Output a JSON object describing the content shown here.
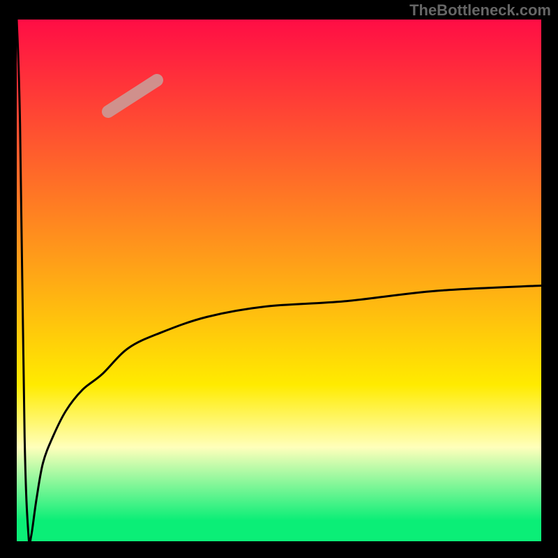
{
  "watermark": "TheBottleneck.com",
  "colors": {
    "top": "#FF0D45",
    "mid1": "#FF9A1A",
    "mid2": "#FFEB00",
    "pale": "#FFFFBB",
    "bottom": "#0BEE77",
    "border": "#000000",
    "curve": "#000000",
    "highlight": "#CC9A96"
  },
  "chart_data": {
    "type": "line",
    "title": "",
    "xlabel": "",
    "ylabel": "",
    "ylim": [
      0,
      100
    ],
    "xlim": [
      0,
      800
    ],
    "x": [
      0,
      5,
      12,
      18,
      22,
      30,
      40,
      55,
      75,
      100,
      130,
      170,
      220,
      290,
      380,
      500,
      640,
      800
    ],
    "y": [
      0,
      20,
      80,
      99,
      99,
      92,
      85,
      80,
      75,
      71,
      68,
      63,
      60,
      57,
      55,
      54,
      52,
      51
    ],
    "gradient_stops": [
      {
        "offset": 0.0,
        "color": "#FF0D45"
      },
      {
        "offset": 0.45,
        "color": "#FF9A1A"
      },
      {
        "offset": 0.7,
        "color": "#FFEB00"
      },
      {
        "offset": 0.82,
        "color": "#FFFFBB"
      },
      {
        "offset": 0.96,
        "color": "#0BEE77"
      },
      {
        "offset": 1.0,
        "color": "#0BEE77"
      }
    ],
    "highlight_segment": {
      "x0": 155,
      "y0": 160,
      "x1": 225,
      "y1": 115,
      "width": 18
    },
    "note": "y is plotted top-down: 0 = top edge, 100 = bottom edge; values are percentage of inner plot height"
  }
}
